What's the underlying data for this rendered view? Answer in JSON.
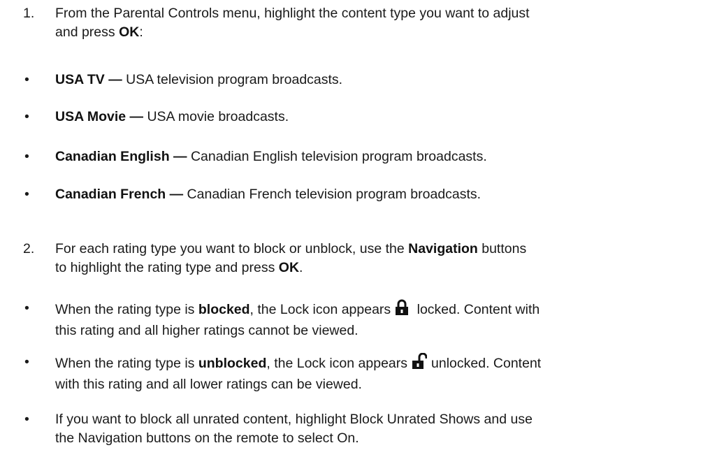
{
  "steps": [
    {
      "number": "1.",
      "line1_before": "From the Parental Controls menu, highlight the content type you want to adjust",
      "line2_before": "and press ",
      "line2_bold": "OK",
      "line2_after": ":"
    },
    {
      "number": "2.",
      "line1_before": "For each rating type you want to block or unblock, use the ",
      "line1_bold": "Navigation",
      "line1_after": " buttons",
      "line2_before": "to highlight the rating type and press ",
      "line2_bold": "OK",
      "line2_after": "."
    }
  ],
  "content_types": [
    {
      "bullet": "•",
      "name": "USA TV —",
      "description": " USA television program broadcasts."
    },
    {
      "bullet": "•",
      "name": "USA Movie —",
      "description": " USA movie broadcasts."
    },
    {
      "bullet": "•",
      "name": "Canadian English —",
      "description": " Canadian English television program broadcasts."
    },
    {
      "bullet": "•",
      "name": "Canadian French —",
      "description": " Canadian French television program broadcasts."
    }
  ],
  "rating_notes": [
    {
      "bullet": "•",
      "line1_before": "When the rating type is ",
      "line1_bold": "blocked",
      "line1_mid": ", the Lock icon appears",
      "icon": "locked-padlock",
      "line1_after": " locked. Content with",
      "line2": "this rating and all higher ratings cannot be viewed."
    },
    {
      "bullet": "•",
      "line1_before": "When the rating type is ",
      "line1_bold": "unblocked",
      "line1_mid": ", the Lock icon appears",
      "icon": "unlocked-padlock",
      "line1_after": "unlocked. Content",
      "line2": "with this rating and all lower ratings can be viewed."
    },
    {
      "bullet": "•",
      "line1": "If you want to block all unrated content, highlight Block Unrated Shows and use",
      "line2": "the Navigation buttons on the remote to select On."
    }
  ]
}
